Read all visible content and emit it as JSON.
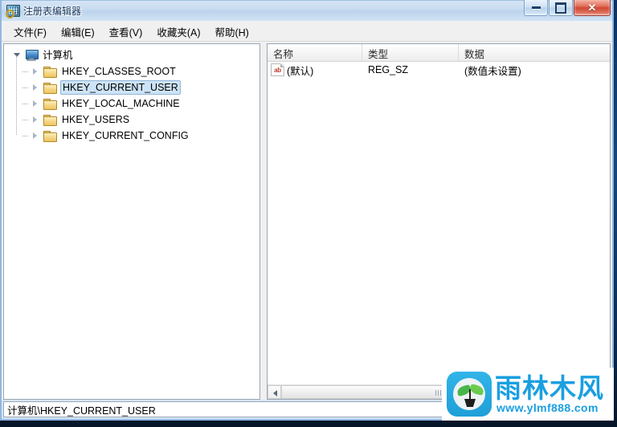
{
  "window": {
    "title": "注册表编辑器",
    "icon": "registry-editor-icon",
    "controls": {
      "minimize": "最小化",
      "maximize": "最大化",
      "close": "关闭",
      "close_glyph": "✕"
    }
  },
  "menubar": {
    "items": [
      {
        "label": "文件(F)",
        "name": "menu-file"
      },
      {
        "label": "编辑(E)",
        "name": "menu-edit"
      },
      {
        "label": "查看(V)",
        "name": "menu-view"
      },
      {
        "label": "收藏夹(A)",
        "name": "menu-favorites"
      },
      {
        "label": "帮助(H)",
        "name": "menu-help"
      }
    ]
  },
  "tree": {
    "root": {
      "label": "计算机",
      "icon": "computer-monitor-icon",
      "expanded": true
    },
    "items": [
      {
        "label": "HKEY_CLASSES_ROOT",
        "icon": "folder-icon",
        "expanded": false,
        "selected": false
      },
      {
        "label": "HKEY_CURRENT_USER",
        "icon": "folder-icon",
        "expanded": false,
        "selected": true
      },
      {
        "label": "HKEY_LOCAL_MACHINE",
        "icon": "folder-icon",
        "expanded": false,
        "selected": false
      },
      {
        "label": "HKEY_USERS",
        "icon": "folder-icon",
        "expanded": false,
        "selected": false
      },
      {
        "label": "HKEY_CURRENT_CONFIG",
        "icon": "folder-icon",
        "expanded": false,
        "selected": false
      }
    ]
  },
  "list": {
    "columns": [
      {
        "label": "名称",
        "name": "column-name"
      },
      {
        "label": "类型",
        "name": "column-type"
      },
      {
        "label": "数据",
        "name": "column-data"
      }
    ],
    "rows": [
      {
        "icon": "string-value-ab-icon",
        "icon_text": "ab",
        "name": "(默认)",
        "type": "REG_SZ",
        "data": "(数值未设置)"
      }
    ],
    "scrollbar": {
      "left_arrow": "◀",
      "right_arrow": "▶"
    }
  },
  "statusbar": {
    "path": "计算机\\HKEY_CURRENT_USER"
  },
  "watermark": {
    "brand_cn": "雨林木风",
    "url": "www.ylmf888.com",
    "logo": "sprout-logo-icon",
    "accent_color": "#1a9fe0"
  }
}
